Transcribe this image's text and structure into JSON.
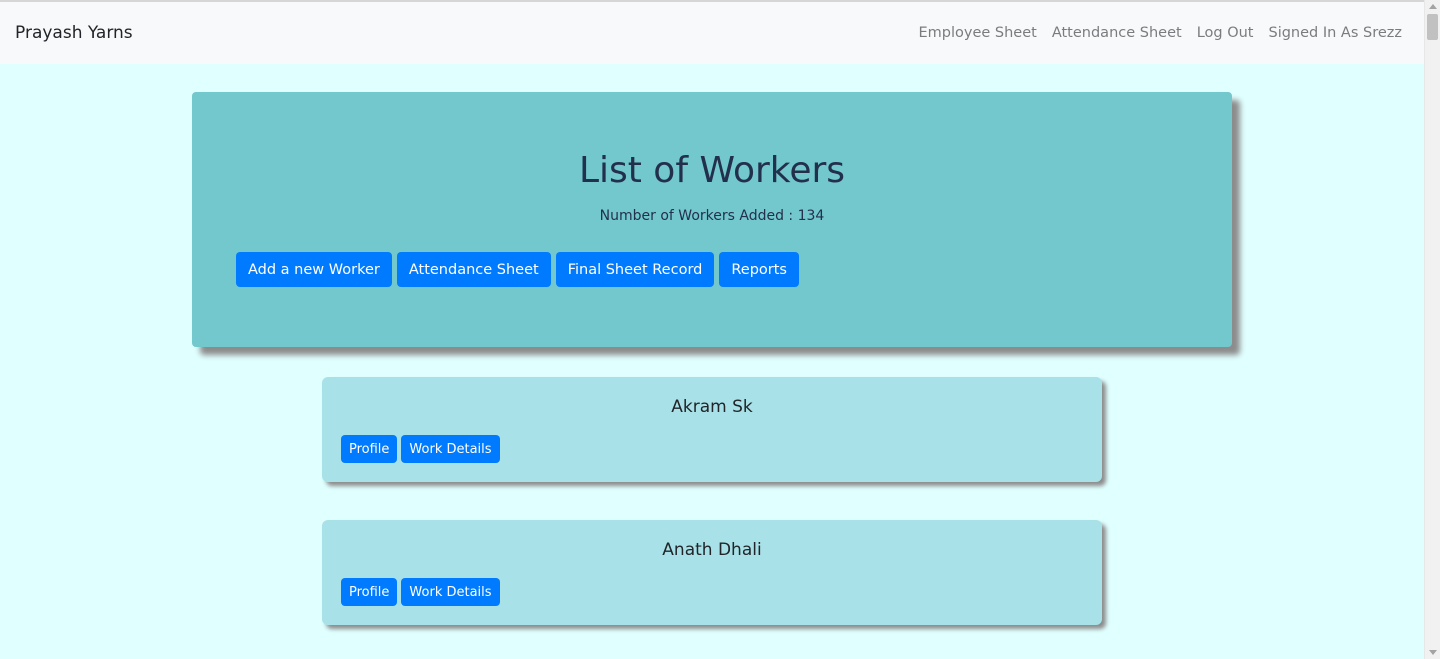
{
  "navbar": {
    "brand": "Prayash Yarns",
    "links": [
      "Employee Sheet",
      "Attendance Sheet",
      "Log Out",
      "Signed In As Srezz"
    ]
  },
  "header": {
    "title": "List of Workers",
    "count_text": "Number of Workers Added : 134",
    "buttons": [
      "Add a new Worker",
      "Attendance Sheet",
      "Final Sheet Record",
      "Reports"
    ]
  },
  "workers": [
    {
      "name": "Akram Sk",
      "profile_label": "Profile",
      "work_label": "Work Details"
    },
    {
      "name": "Anath Dhali",
      "profile_label": "Profile",
      "work_label": "Work Details"
    }
  ],
  "colors": {
    "page_bg": "#e0ffff",
    "jumbotron_bg": "#72c8cd",
    "card_bg": "#a8e2e8",
    "button_primary": "#007bff"
  }
}
